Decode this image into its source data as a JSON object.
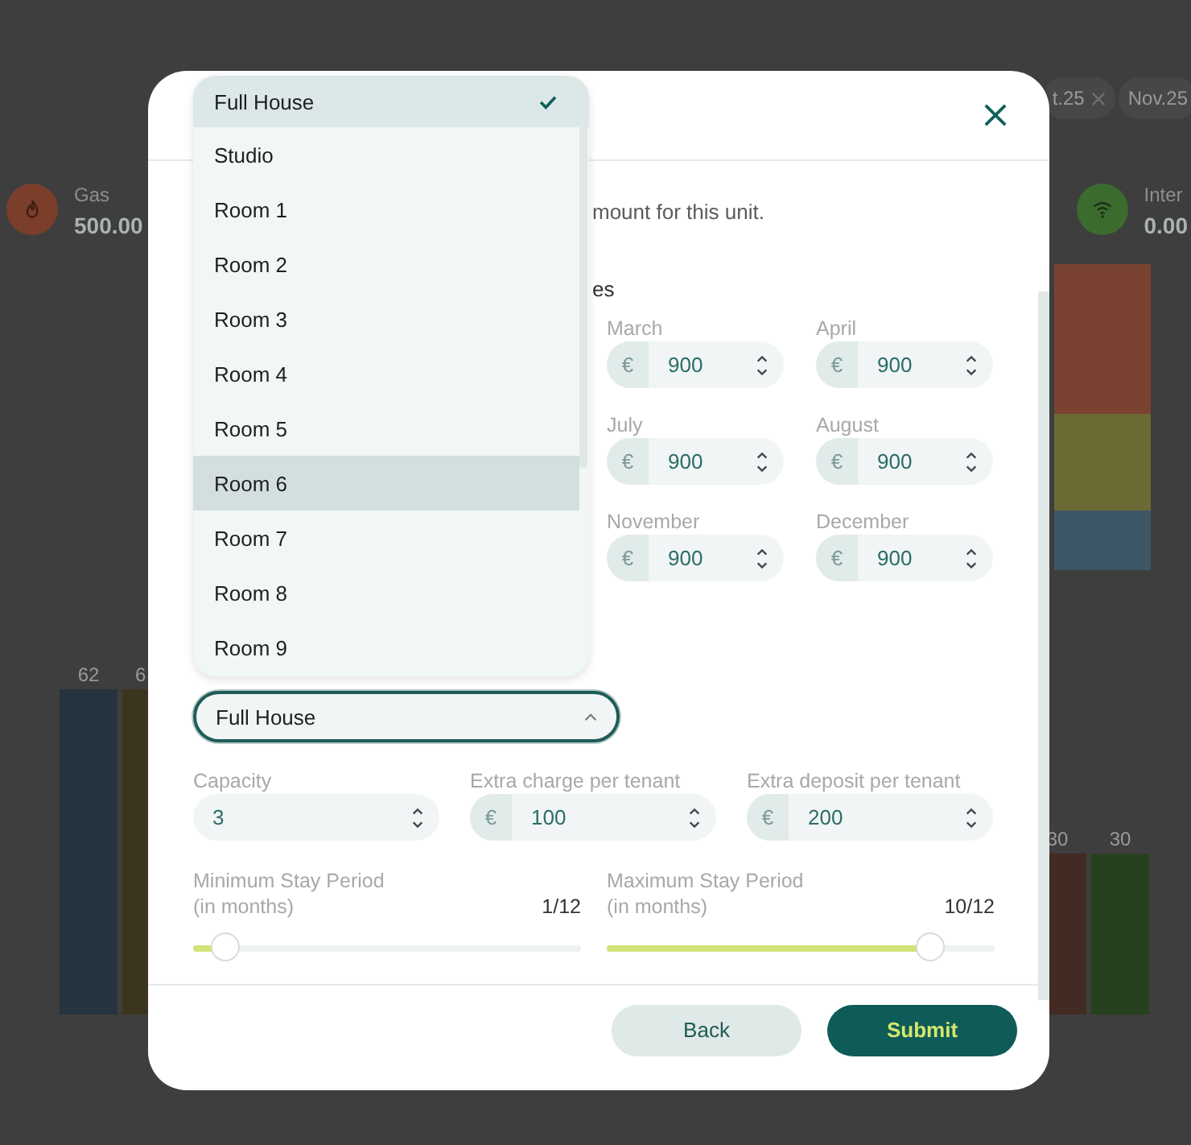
{
  "background": {
    "filter_chips": [
      {
        "label": "t.25",
        "removable": true
      },
      {
        "label": "Nov.25"
      }
    ],
    "stats": [
      {
        "label": "Gas",
        "value": "500.00",
        "color": "#7a3e2b"
      },
      {
        "label": "Inter",
        "value": "0.00",
        "color": "#3c6b2e"
      }
    ],
    "stacked_bar": [
      {
        "color": "#7a4331"
      },
      {
        "color": "#6b6a35"
      },
      {
        "color": "#3e5767"
      }
    ],
    "left_bars": [
      {
        "label": "62",
        "color": "#263440"
      },
      {
        "label": "6",
        "color": "#3b3520"
      }
    ],
    "right_bars": [
      {
        "label": "30",
        "color": "#432a22"
      },
      {
        "label": "30",
        "color": "#27401f"
      }
    ]
  },
  "modal": {
    "description": "mount for this unit.",
    "section_heading": "es",
    "months": [
      {
        "label": "March",
        "currency": "€",
        "value": "900"
      },
      {
        "label": "April",
        "currency": "€",
        "value": "900"
      },
      {
        "label": "July",
        "currency": "€",
        "value": "900"
      },
      {
        "label": "August",
        "currency": "€",
        "value": "900"
      },
      {
        "label": "November",
        "currency": "€",
        "value": "900"
      },
      {
        "label": "December",
        "currency": "€",
        "value": "900"
      }
    ],
    "unit_select": {
      "value": "Full House",
      "expanded": true
    },
    "dropdown": [
      {
        "label": "Full House",
        "selected": true,
        "highlighted": false
      },
      {
        "label": "Studio",
        "selected": false,
        "highlighted": false
      },
      {
        "label": "Room 1",
        "selected": false,
        "highlighted": false
      },
      {
        "label": "Room 2",
        "selected": false,
        "highlighted": false
      },
      {
        "label": "Room 3",
        "selected": false,
        "highlighted": false
      },
      {
        "label": "Room 4",
        "selected": false,
        "highlighted": false
      },
      {
        "label": "Room 5",
        "selected": false,
        "highlighted": false
      },
      {
        "label": "Room 6",
        "selected": false,
        "highlighted": true
      },
      {
        "label": "Room 7",
        "selected": false,
        "highlighted": false
      },
      {
        "label": "Room 8",
        "selected": false,
        "highlighted": false
      },
      {
        "label": "Room 9",
        "selected": false,
        "highlighted": false
      }
    ],
    "tenant_fields": [
      {
        "label": "Capacity",
        "value": "3"
      },
      {
        "label": "Extra charge per tenant",
        "currency": "€",
        "value": "100"
      },
      {
        "label": "Extra deposit per tenant",
        "currency": "€",
        "value": "200"
      }
    ],
    "stay_periods": [
      {
        "label": "Minimum Stay Period",
        "hint": "(in months)",
        "reading": "1/12",
        "level": 0.083
      },
      {
        "label": "Maximum Stay Period",
        "hint": "(in months)",
        "reading": "10/12",
        "level": 0.833
      }
    ],
    "buttons": [
      {
        "label": "Back",
        "kind": "secondary"
      },
      {
        "label": "Submit",
        "kind": "primary"
      }
    ]
  }
}
